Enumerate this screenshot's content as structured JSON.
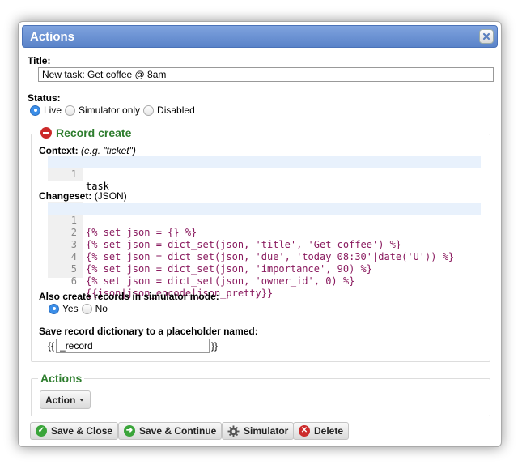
{
  "dialog": {
    "title": "Actions",
    "close_icon": "close-icon"
  },
  "title_field": {
    "label": "Title:",
    "value": "New task: Get coffee @ 8am"
  },
  "status": {
    "label": "Status:",
    "options": [
      "Live",
      "Simulator only",
      "Disabled"
    ],
    "selected": "Live"
  },
  "record_create": {
    "legend": "Record create",
    "context": {
      "label": "Context:",
      "hint": "(e.g. \"ticket\")",
      "lines": [
        "task"
      ]
    },
    "changeset": {
      "label": "Changeset:",
      "hint": "(JSON)",
      "lines": [
        "{% set json = {} %}",
        "{% set json = dict_set(json, 'title', 'Get coffee') %}",
        "{% set json = dict_set(json, 'due', 'today 08:30'|date('U')) %}",
        "{% set json = dict_set(json, 'importance', 90) %}",
        "{% set json = dict_set(json, 'owner_id', 0) %}",
        "{{json|json_encode|json_pretty}}"
      ]
    },
    "simulator_mode": {
      "label": "Also create records in simulator mode:",
      "options": [
        "Yes",
        "No"
      ],
      "selected": "Yes"
    },
    "placeholder": {
      "label": "Save record dictionary to a placeholder named:",
      "prefix": "{{",
      "value": "_record",
      "suffix": "}}"
    }
  },
  "actions_section": {
    "legend": "Actions",
    "action_button": "Action"
  },
  "footer": {
    "save_close": "Save & Close",
    "save_continue": "Save & Continue",
    "simulator": "Simulator",
    "delete": "Delete"
  },
  "colors": {
    "titlebar": "#5a83c9",
    "legend_green": "#2e7d2e",
    "check_green": "#3aa53a",
    "delete_red": "#cc2a2a",
    "radio_blue": "#3b8ee8"
  }
}
